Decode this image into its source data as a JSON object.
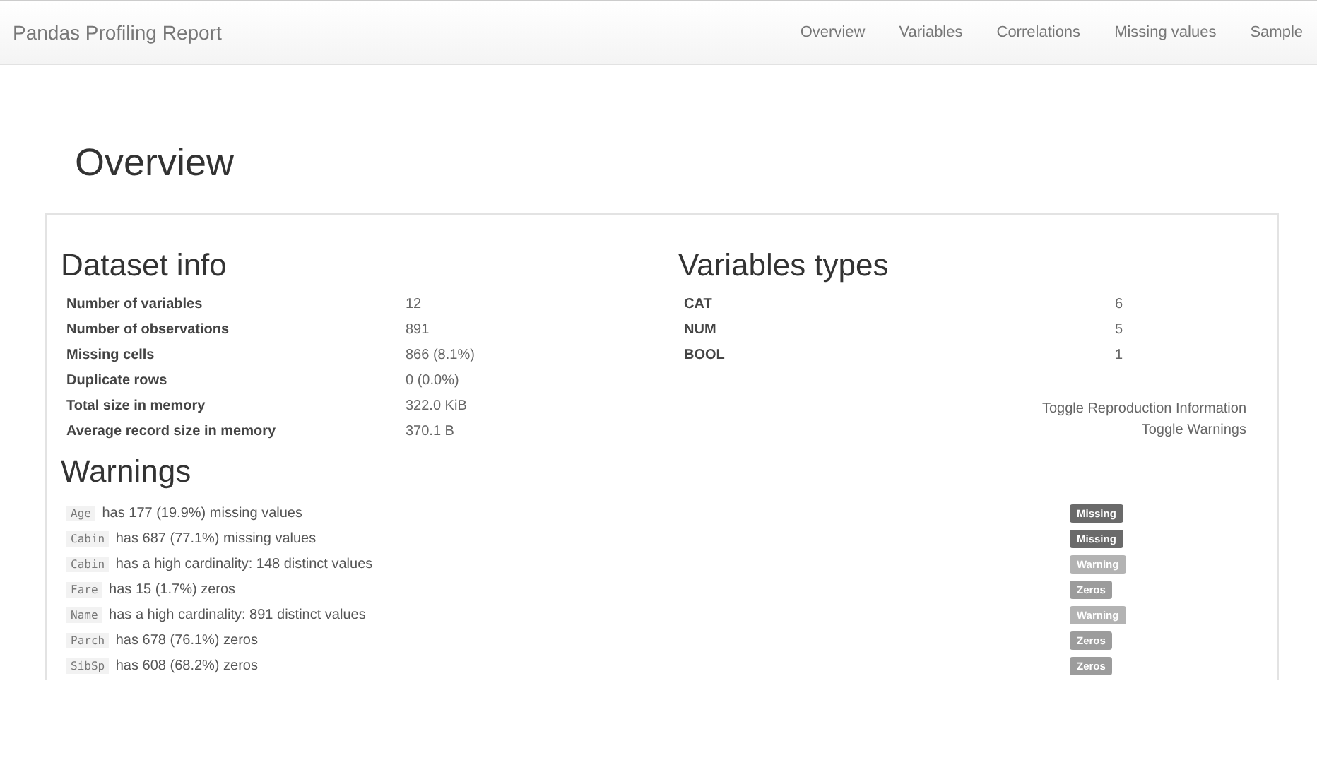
{
  "navbar": {
    "brand": "Pandas Profiling Report",
    "links": [
      "Overview",
      "Variables",
      "Correlations",
      "Missing values",
      "Sample"
    ]
  },
  "page_title": "Overview",
  "dataset_info": {
    "title": "Dataset info",
    "rows": [
      {
        "label": "Number of variables",
        "value": "12"
      },
      {
        "label": "Number of observations",
        "value": "891"
      },
      {
        "label": "Missing cells",
        "value": "866 (8.1%)"
      },
      {
        "label": "Duplicate rows",
        "value": "0 (0.0%)"
      },
      {
        "label": "Total size in memory",
        "value": "322.0 KiB"
      },
      {
        "label": "Average record size in memory",
        "value": "370.1 B"
      }
    ]
  },
  "variable_types": {
    "title": "Variables types",
    "rows": [
      {
        "label": "CAT",
        "value": "6"
      },
      {
        "label": "NUM",
        "value": "5"
      },
      {
        "label": "BOOL",
        "value": "1"
      }
    ]
  },
  "toggle_links": [
    "Toggle Reproduction Information",
    "Toggle Warnings"
  ],
  "warnings": {
    "title": "Warnings",
    "items": [
      {
        "variable": "Age",
        "text": "has 177 (19.9%) missing values",
        "badge": "Missing",
        "kind": "missing"
      },
      {
        "variable": "Cabin",
        "text": "has 687 (77.1%) missing values",
        "badge": "Missing",
        "kind": "missing"
      },
      {
        "variable": "Cabin",
        "text": "has a high cardinality: 148 distinct values",
        "badge": "Warning",
        "kind": "warning"
      },
      {
        "variable": "Fare",
        "text": "has 15 (1.7%) zeros",
        "badge": "Zeros",
        "kind": "zeros"
      },
      {
        "variable": "Name",
        "text": "has a high cardinality: 891 distinct values",
        "badge": "Warning",
        "kind": "warning"
      },
      {
        "variable": "Parch",
        "text": "has 678 (76.1%) zeros",
        "badge": "Zeros",
        "kind": "zeros"
      },
      {
        "variable": "SibSp",
        "text": "has 608 (68.2%) zeros",
        "badge": "Zeros",
        "kind": "zeros"
      }
    ]
  }
}
